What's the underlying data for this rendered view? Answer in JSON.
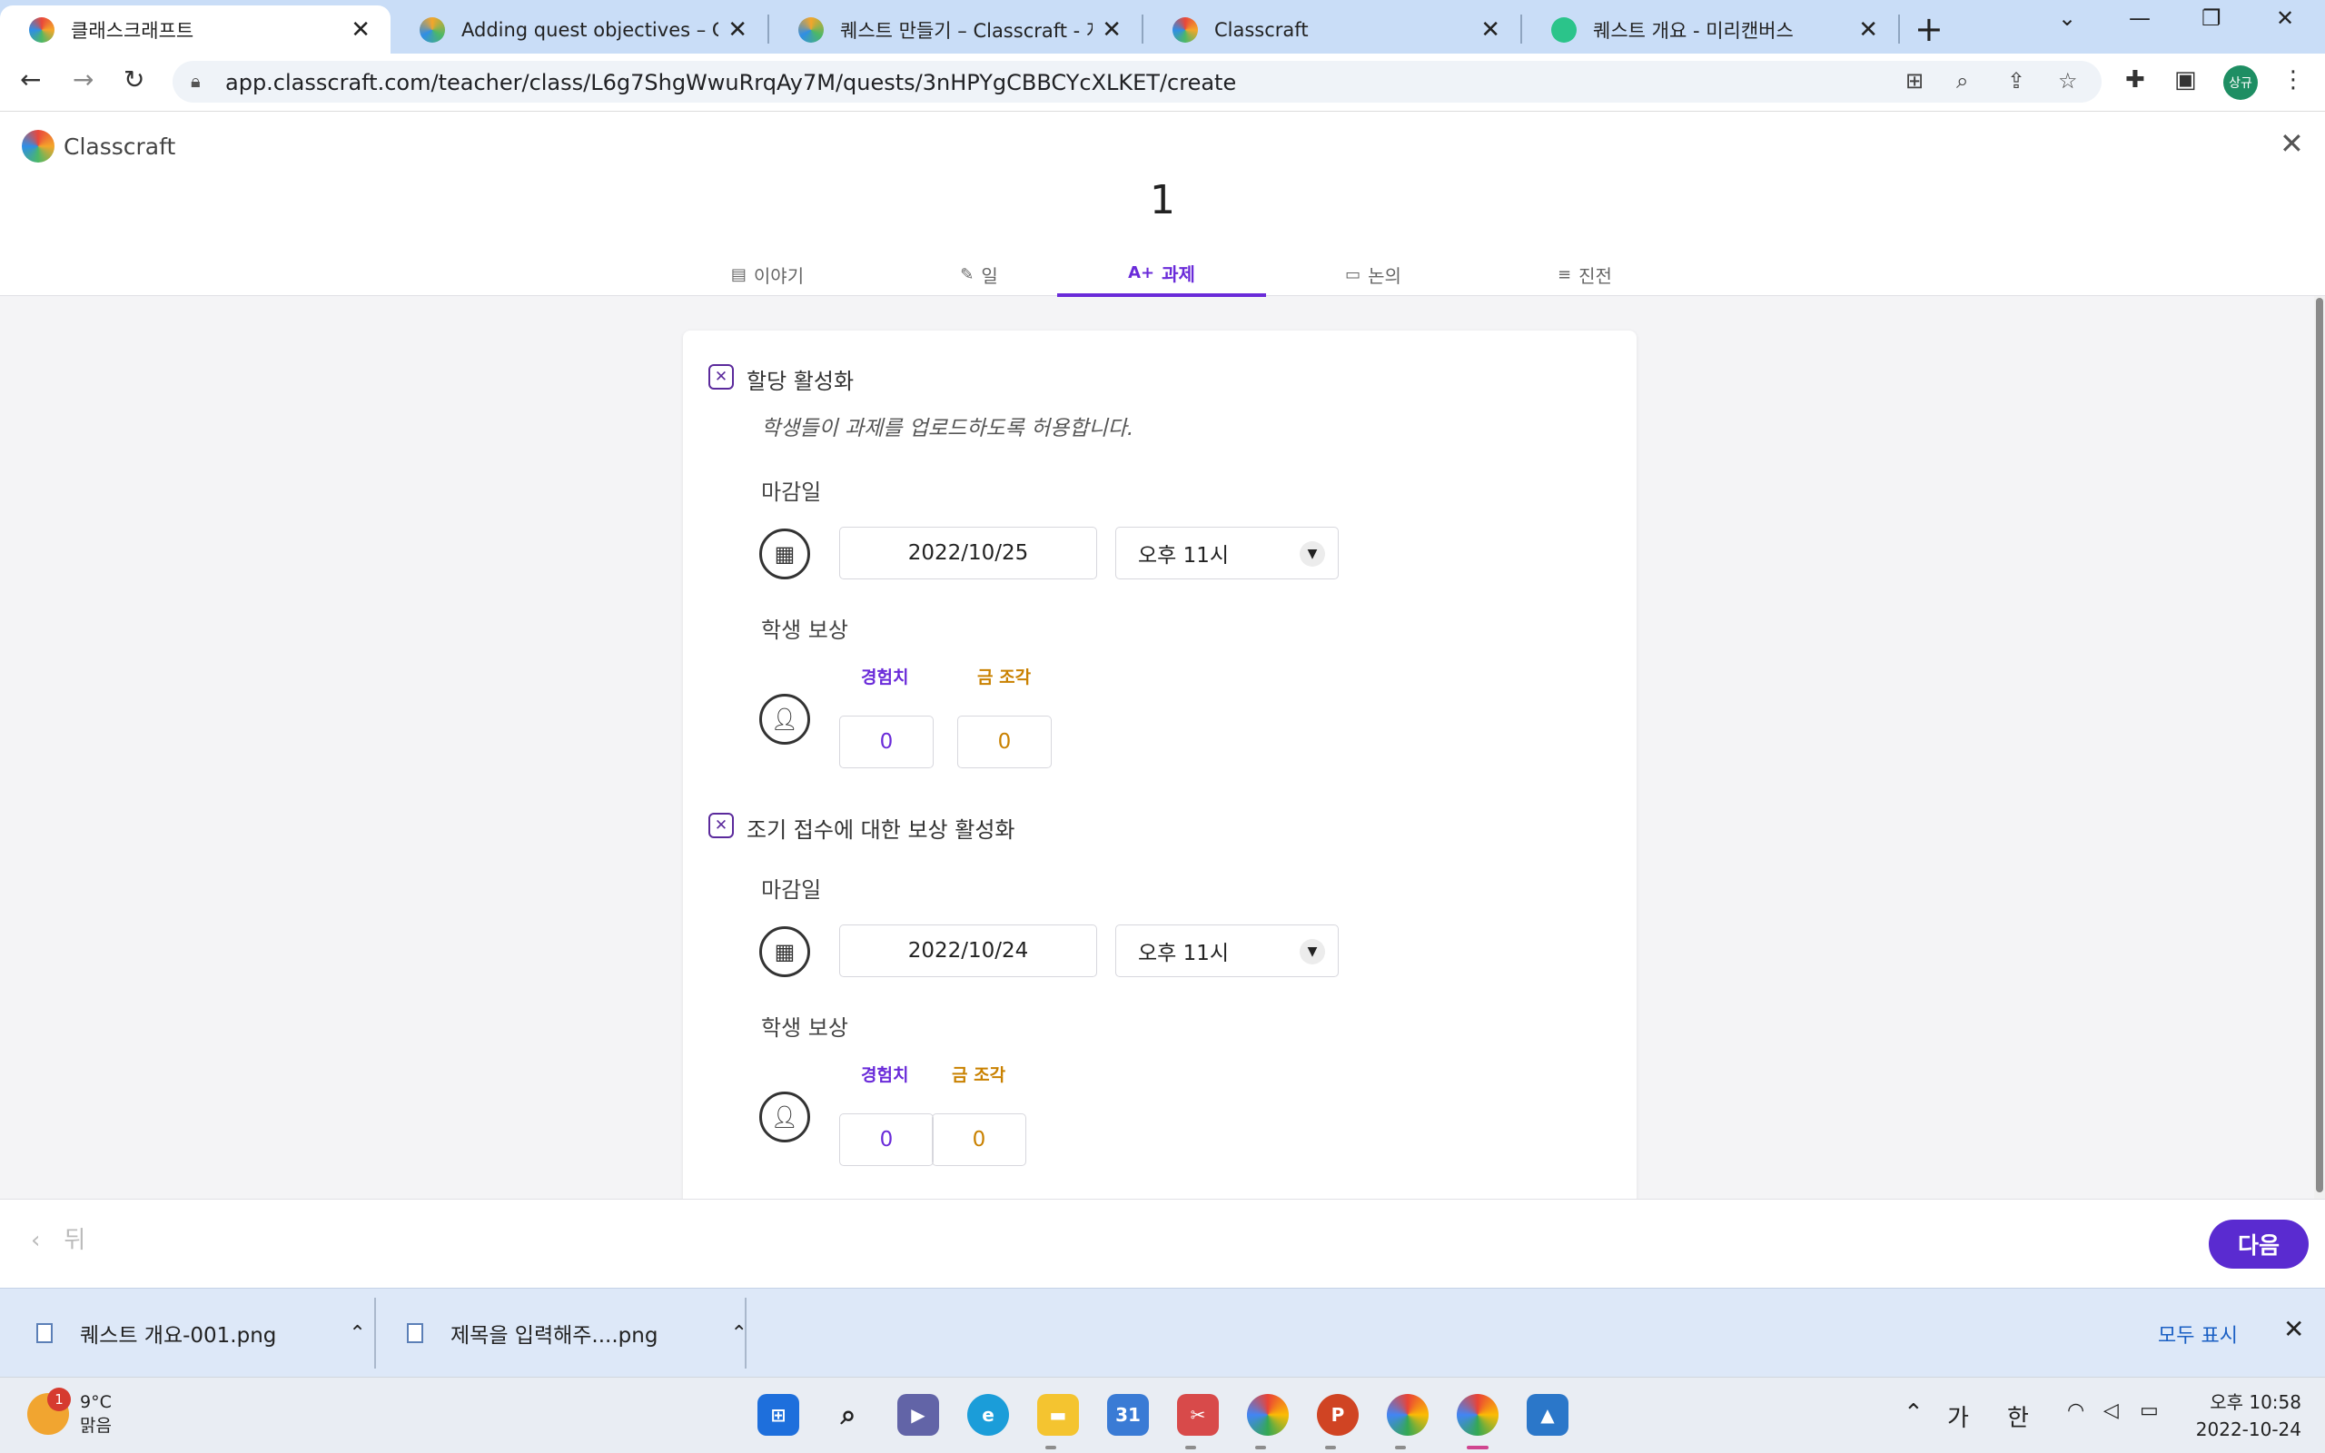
{
  "browser": {
    "tabs": [
      {
        "title": "클래스크래프트",
        "active": true
      },
      {
        "title": "Adding quest objectives – Class",
        "active": false
      },
      {
        "title": "퀘스트 만들기 – Classcraft - 지",
        "active": false
      },
      {
        "title": "Classcraft",
        "active": false
      },
      {
        "title": "퀘스트 개요 - 미리캔버스",
        "active": false
      }
    ],
    "url": "app.classcraft.com/teacher/class/L6g7ShgWwuRrqAy7M/quests/3nHPYgCBBCYcXLKET/create",
    "profile_label": "상규"
  },
  "app": {
    "logo_text": "Classcraft",
    "quest_number": "1",
    "tabs": [
      {
        "icon": "book-icon",
        "label": "이야기"
      },
      {
        "icon": "edit-icon",
        "label": "일"
      },
      {
        "icon": "grade-icon",
        "icon_text": "A+",
        "label": "과제"
      },
      {
        "icon": "chat-icon",
        "label": "논의"
      },
      {
        "icon": "progress-icon",
        "label": "진전"
      }
    ]
  },
  "assignment": {
    "enable_label": "할당 활성화",
    "description": "학생들이 과제를 업로드하도록 허용합니다.",
    "due_label": "마감일",
    "due_date": "2022/10/25",
    "due_time": "오후 11시",
    "reward_label": "학생 보상",
    "xp_label": "경험치",
    "gold_label": "금 조각",
    "xp_value": "0",
    "gold_value": "0"
  },
  "early_reward": {
    "enable_label": "조기 접수에 대한 보상 활성화",
    "due_label": "마감일",
    "due_date": "2022/10/24",
    "due_time": "오후 11시",
    "reward_label": "학생 보상",
    "xp_label": "경험치",
    "gold_label": "금 조각",
    "xp_value": "0",
    "gold_value": "0"
  },
  "footer": {
    "back_label": "뒤",
    "next_label": "다음"
  },
  "downloads": {
    "items": [
      "퀘스트 개요-001.png",
      "제목을 입력해주....png"
    ],
    "show_all": "모두 표시"
  },
  "taskbar": {
    "weather_badge": "1",
    "temperature": "9°C",
    "condition": "맑음",
    "ime_1": "가",
    "ime_2": "한",
    "time": "오후 10:58",
    "date": "2022-10-24",
    "calendar_day": "31"
  },
  "colors": {
    "accent": "#6a2bd9",
    "next_button": "#5a2bd0",
    "gold": "#c98100",
    "checkbox": "#5b2a9c",
    "tabstrip": "#c9ddf7"
  }
}
